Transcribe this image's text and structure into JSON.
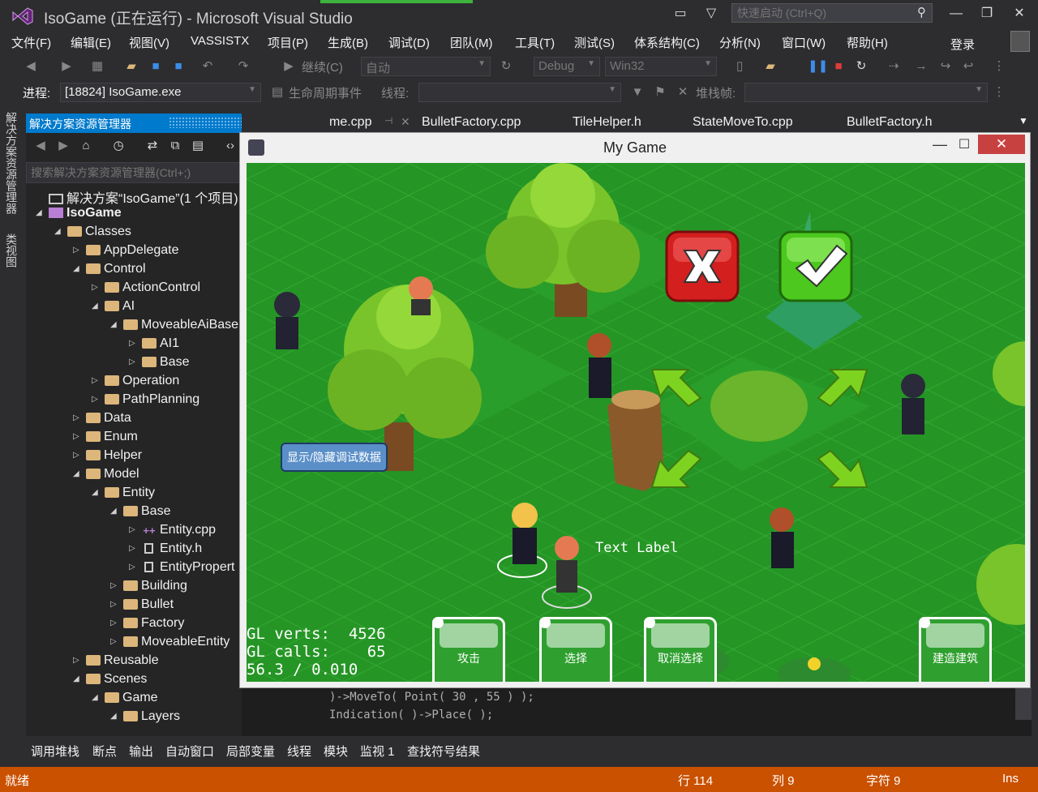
{
  "titlebar": {
    "title": "IsoGame (正在运行) - Microsoft Visual Studio",
    "quick_launch_placeholder": "快速启动 (Ctrl+Q)"
  },
  "menu": [
    "文件(F)",
    "编辑(E)",
    "视图(V)",
    "VASSISTX",
    "项目(P)",
    "生成(B)",
    "调试(D)",
    "团队(M)",
    "工具(T)",
    "测试(S)",
    "体系结构(C)",
    "分析(N)",
    "窗口(W)",
    "帮助(H)"
  ],
  "login": "登录",
  "toolbar": {
    "continue": "继续(C)",
    "auto": "自动",
    "config": "Debug",
    "platform": "Win32"
  },
  "toolbar2": {
    "process_label": "进程:",
    "process_value": "[18824] IsoGame.exe",
    "lifecycle": "生命周期事件",
    "thread_label": "线程:",
    "stack_label": "堆栈帧:"
  },
  "left_strip": {
    "tab1": "解决方案资源管理器",
    "tab2": "类视图"
  },
  "solution_explorer": {
    "title": "解决方案资源管理器",
    "search_placeholder": "搜索解决方案资源管理器(Ctrl+;)",
    "nodes": [
      {
        "label": "解决方案“IsoGame”(1 个项目)",
        "depth": 0,
        "exp": "",
        "kind": "sol"
      },
      {
        "label": "IsoGame",
        "depth": 0,
        "exp": "◢",
        "kind": "proj"
      },
      {
        "label": "Classes",
        "depth": 1,
        "exp": "◢",
        "kind": "folder"
      },
      {
        "label": "AppDelegate",
        "depth": 2,
        "exp": "▷",
        "kind": "folder"
      },
      {
        "label": "Control",
        "depth": 2,
        "exp": "◢",
        "kind": "folder"
      },
      {
        "label": "ActionControl",
        "depth": 3,
        "exp": "▷",
        "kind": "folder"
      },
      {
        "label": "AI",
        "depth": 3,
        "exp": "◢",
        "kind": "folder"
      },
      {
        "label": "MoveableAiBase",
        "depth": 4,
        "exp": "◢",
        "kind": "folder"
      },
      {
        "label": "AI1",
        "depth": 5,
        "exp": "▷",
        "kind": "folder"
      },
      {
        "label": "Base",
        "depth": 5,
        "exp": "▷",
        "kind": "folder"
      },
      {
        "label": "Operation",
        "depth": 3,
        "exp": "▷",
        "kind": "folder"
      },
      {
        "label": "PathPlanning",
        "depth": 3,
        "exp": "▷",
        "kind": "folder"
      },
      {
        "label": "Data",
        "depth": 2,
        "exp": "▷",
        "kind": "folder"
      },
      {
        "label": "Enum",
        "depth": 2,
        "exp": "▷",
        "kind": "folder"
      },
      {
        "label": "Helper",
        "depth": 2,
        "exp": "▷",
        "kind": "folder"
      },
      {
        "label": "Model",
        "depth": 2,
        "exp": "◢",
        "kind": "folder"
      },
      {
        "label": "Entity",
        "depth": 3,
        "exp": "◢",
        "kind": "folder"
      },
      {
        "label": "Base",
        "depth": 4,
        "exp": "◢",
        "kind": "folder"
      },
      {
        "label": "Entity.cpp",
        "depth": 5,
        "exp": "▷",
        "kind": "cpp"
      },
      {
        "label": "Entity.h",
        "depth": 5,
        "exp": "▷",
        "kind": "h"
      },
      {
        "label": "EntityPropert",
        "depth": 5,
        "exp": "▷",
        "kind": "h"
      },
      {
        "label": "Building",
        "depth": 4,
        "exp": "▷",
        "kind": "folder"
      },
      {
        "label": "Bullet",
        "depth": 4,
        "exp": "▷",
        "kind": "folder"
      },
      {
        "label": "Factory",
        "depth": 4,
        "exp": "▷",
        "kind": "folder"
      },
      {
        "label": "MoveableEntity",
        "depth": 4,
        "exp": "▷",
        "kind": "folder"
      },
      {
        "label": "Reusable",
        "depth": 2,
        "exp": "▷",
        "kind": "folder"
      },
      {
        "label": "Scenes",
        "depth": 2,
        "exp": "◢",
        "kind": "folder"
      },
      {
        "label": "Game",
        "depth": 3,
        "exp": "◢",
        "kind": "folder"
      },
      {
        "label": "Layers",
        "depth": 4,
        "exp": "◢",
        "kind": "folder"
      }
    ]
  },
  "doc_tabs": [
    "me.cpp",
    "BulletFactory.cpp",
    "TileHelper.h",
    "StateMoveTo.cpp",
    "BulletFactory.h"
  ],
  "code_lines": [
    ")->MoveTo( Point( 30 , 55 ) );",
    "Indication( )->Place( );"
  ],
  "game_window": {
    "title": "My Game",
    "debug_button": "显示/隐藏调试数据",
    "text_label": "Text Label",
    "stats": "GL verts:  4526\nGL calls:    65\n56.3 / 0.010",
    "actions": [
      "攻击",
      "选择",
      "取消选择",
      "建造建筑"
    ]
  },
  "bottom_tabs": [
    "调用堆栈",
    "断点",
    "输出",
    "自动窗口",
    "局部变量",
    "线程",
    "模块",
    "监视 1",
    "查找符号结果"
  ],
  "status": {
    "ready": "就绪",
    "line": "行 114",
    "col": "列 9",
    "char": "字符 9",
    "mode": "Ins"
  },
  "colors": {
    "accent": "#007acc",
    "status": "#ca5100",
    "running": "#3db33d"
  }
}
